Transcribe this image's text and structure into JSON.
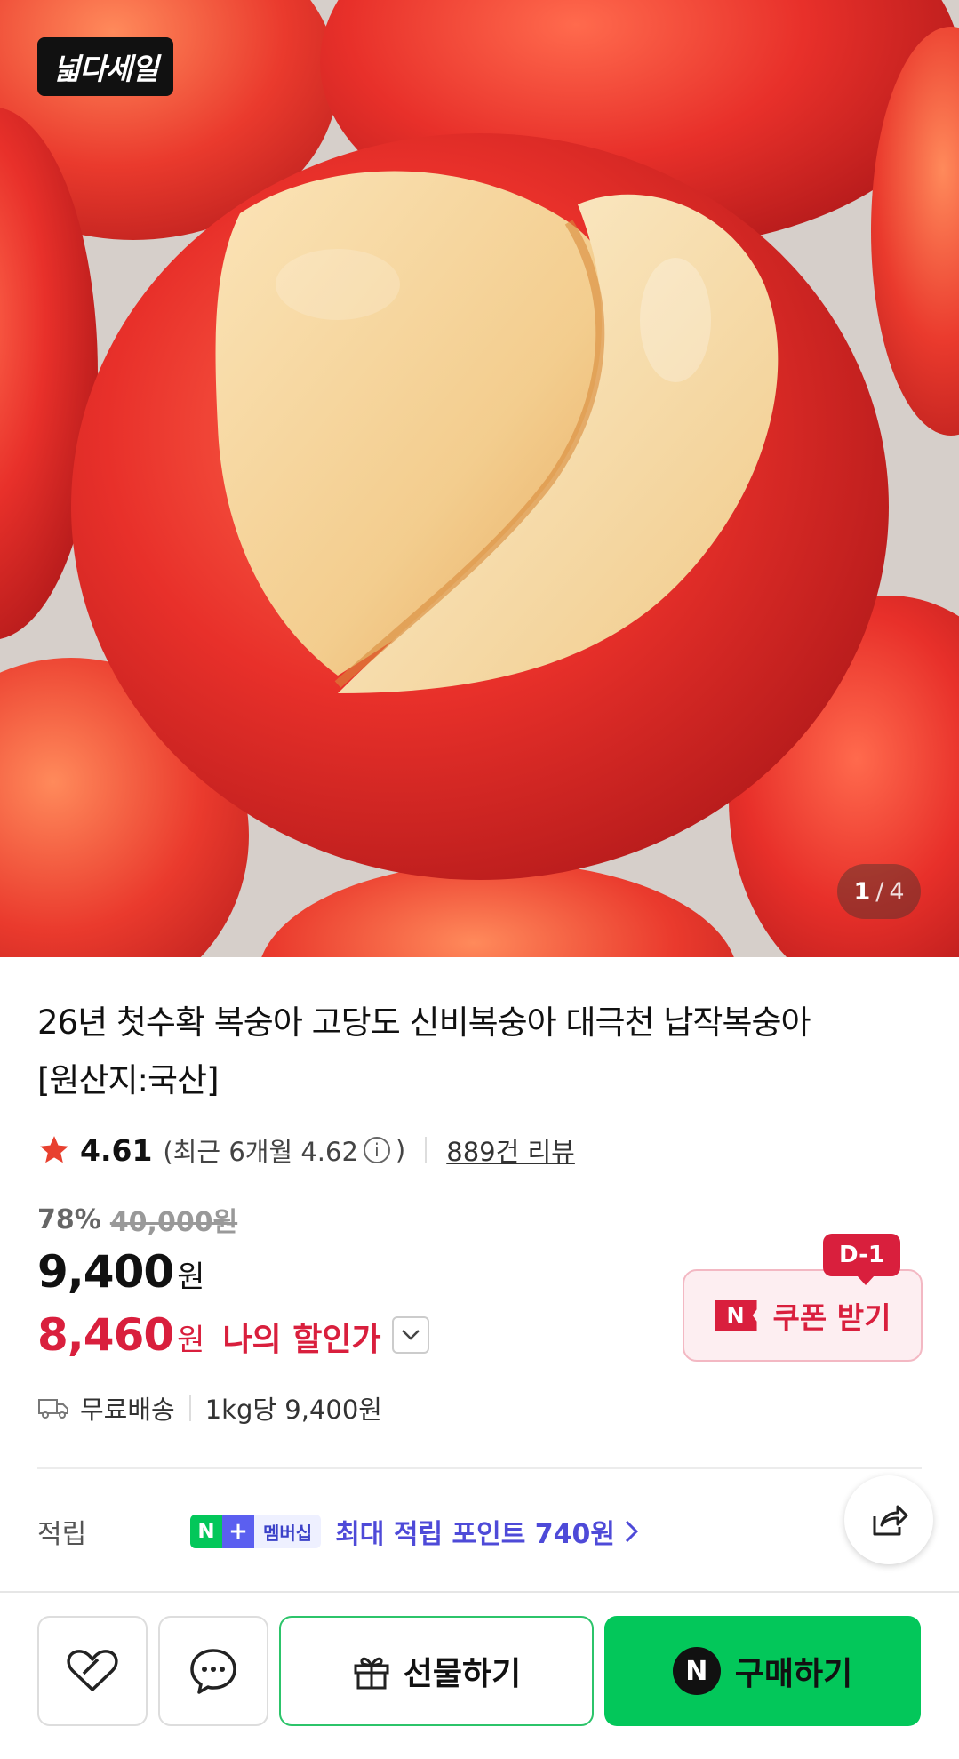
{
  "hero": {
    "badge": "넓다세일",
    "image_counter": {
      "current": "1",
      "separator": "/",
      "total": "4"
    }
  },
  "product": {
    "title_line1": "26년 첫수확 복숭아 고당도 신비복숭아 대극천 납작복숭아",
    "title_line2": "[원산지:국산]",
    "rating": "4.61",
    "recent_rating_prefix": "(최근 6개월 4.62",
    "recent_rating_suffix": ")",
    "review_count": "889건 리뷰",
    "discount_rate": "78%",
    "original_price": "40,000원",
    "price": "9,400",
    "price_unit": "원",
    "my_price": "8,460",
    "my_price_unit": "원",
    "my_price_label": "나의 할인가"
  },
  "coupon": {
    "day_badge": "D-1",
    "n_mark": "N",
    "label": "쿠폰 받기"
  },
  "shipping": {
    "delivery": "무료배송",
    "unit_price": "1kg당 9,400원"
  },
  "points": {
    "label": "적립",
    "badge_n": "N",
    "badge_plus": "+",
    "badge_membership": "멤버십",
    "text": "최대 적립 포인트 740원"
  },
  "actions": {
    "gift_label": "선물하기",
    "buy_n": "N",
    "buy_label": "구매하기"
  },
  "colors": {
    "accent_red": "#d91f3d",
    "naver_green": "#03c75a",
    "points_purple": "#4e4ad8"
  }
}
